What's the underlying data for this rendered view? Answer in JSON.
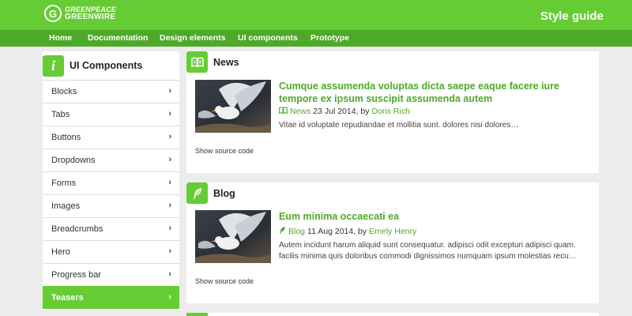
{
  "header": {
    "logo_line1": "GREENPEACE",
    "logo_line2": "GREENWIRE",
    "site_title": "Style guide"
  },
  "nav": [
    "Home",
    "Documentation",
    "Design elements",
    "UI components",
    "Prototype"
  ],
  "sidebar": {
    "title": "UI Components",
    "items": [
      {
        "label": "Blocks"
      },
      {
        "label": "Tabs"
      },
      {
        "label": "Buttons"
      },
      {
        "label": "Dropdowns"
      },
      {
        "label": "Forms"
      },
      {
        "label": "Images"
      },
      {
        "label": "Breadcrumbs"
      },
      {
        "label": "Hero"
      },
      {
        "label": "Progress bar"
      },
      {
        "label": "Teasers",
        "active": true
      }
    ]
  },
  "news": {
    "title": "News",
    "teaser_title": "Cumque assumenda voluptas dicta saepe eaque facere iure tempore ex ipsum suscipit assumenda autem",
    "tag": "News",
    "date": "23 Jul 2014",
    "by": ", by",
    "author": "Doris Rich",
    "excerpt": "Vitae id voluptate repudiandae et mollitia sunt. dolores nisi dolores…",
    "source": "Show source code"
  },
  "blog": {
    "title": "Blog",
    "teaser_title": "Eum minima occaecati ea",
    "tag": "Blog",
    "date": "11 Aug 2014",
    "by": ", by",
    "author": "Emely Henry",
    "excerpt": "Autem incidunt harum aliquid sunt consequatur. adipisci odit excepturi adipisci quam. facilis minima quis doloribus commodi dignissimos numquam ipsum molestias recu…",
    "source": "Show source code"
  },
  "colors": {
    "brand": "#66cc33",
    "nav": "#4fa929",
    "link": "#4fa929"
  }
}
